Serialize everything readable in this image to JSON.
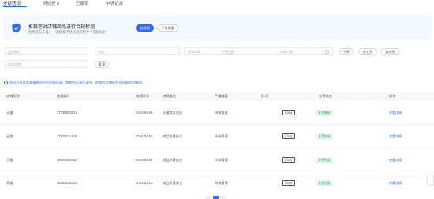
{
  "tabs": [
    {
      "label": "全部违规"
    },
    {
      "label": "待处理 0"
    },
    {
      "label": "已撤销"
    },
    {
      "label": "申诉记录"
    }
  ],
  "banner": {
    "title": "推荐您对店铺商品进行合规检测",
    "subtitle": "使用官方工具，一键批量评估违规风险并 “问题商品”",
    "primary_button": "去检测",
    "secondary_button": "不再提醒",
    "accent_color": "#2f6cf6"
  },
  "filters": {
    "code_placeholder": "违规编号",
    "type_placeholder": "全部",
    "date_label": "违规时间",
    "date_start_placeholder": "开始日期",
    "date_end_placeholder": "结束日期",
    "shop_placeholder": "店铺名称",
    "chips": [
      "今天",
      "近七天",
      "近30天"
    ],
    "search_button": "搜 索"
  },
  "notice": "您可以在此处查看两年内的违规记录，超期的记录会清除，相关的店铺处罚也可能同步解除。",
  "table": {
    "columns": [
      "店铺昵称",
      "违规编号",
      "违规时间",
      "违规类型",
      "严重程度",
      "扣分",
      "处罚状态",
      "操作"
    ],
    "rows": [
      {
        "shop": "天猫",
        "code": "37738653021",
        "time": "2024-04-08",
        "type": "天猫商家违规",
        "severity": "市场管理",
        "points": "扣0分",
        "status": "处罚撤销",
        "action": "查看详情"
      },
      {
        "shop": "天猫",
        "code": "37578721128",
        "time": "2024-04-02",
        "type": "商品质量安全",
        "severity": "市场管理",
        "points": "扣0分",
        "status": "处罚完成",
        "action": "查看详情"
      },
      {
        "shop": "天猫",
        "code": "36925392264",
        "time": "2024-01-28",
        "type": "商品质量安全",
        "severity": "市场管理",
        "points": "扣0分",
        "status": "处罚完成",
        "action": "查看详情"
      },
      {
        "shop": "天猫",
        "code": "36580516242",
        "time": "2024-01-12",
        "type": "商品质量安全",
        "severity": "市场管理",
        "points": "扣0分",
        "status": "处罚完成",
        "action": "查看详情"
      }
    ]
  }
}
